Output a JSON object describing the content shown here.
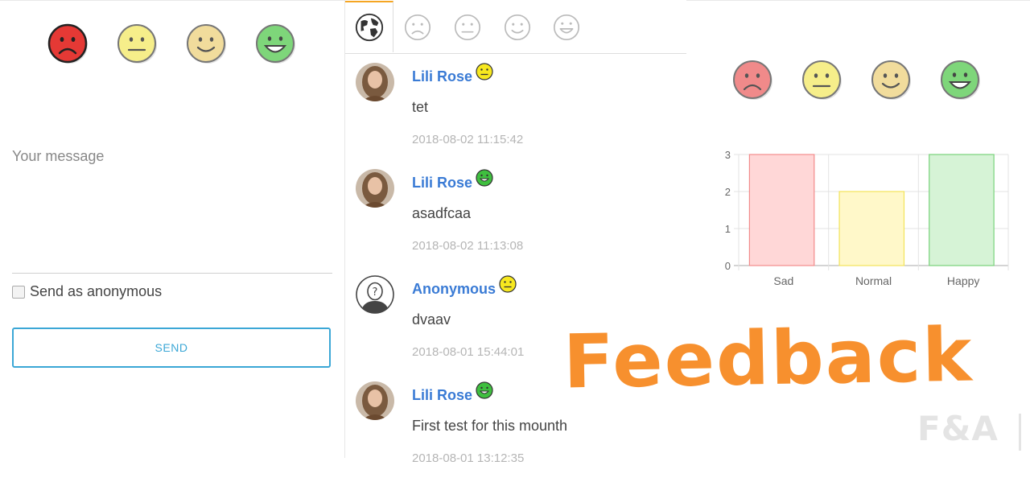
{
  "form": {
    "message_placeholder": "Your message",
    "anonymous_label": "Send as anonymous",
    "send_label": "SEND",
    "moods": [
      {
        "name": "sad",
        "color": "#e53935"
      },
      {
        "name": "normal",
        "color": "#f6ee8a"
      },
      {
        "name": "happy",
        "color": "#f1dc9c"
      },
      {
        "name": "very-happy",
        "color": "#7ed67a"
      }
    ]
  },
  "feed": {
    "tabs": [
      "globe-icon",
      "sad-face-icon",
      "neutral-face-icon",
      "smile-face-icon",
      "happy-face-icon"
    ],
    "accent": "#f5a623",
    "items": [
      {
        "name": "Lili Rose",
        "mood": "neutral",
        "text": "tet",
        "time": "2018-08-02 11:15:42",
        "avatar": "photo"
      },
      {
        "name": "Lili Rose",
        "mood": "happy",
        "text": "asadfcaa",
        "time": "2018-08-02 11:13:08",
        "avatar": "photo"
      },
      {
        "name": "Anonymous",
        "mood": "neutral",
        "text": "dvaav",
        "time": "2018-08-01 15:44:01",
        "avatar": "anonymous"
      },
      {
        "name": "Lili Rose",
        "mood": "happy",
        "text": "First test for this mounth",
        "time": "2018-08-01 13:12:35",
        "avatar": "photo"
      }
    ]
  },
  "stats": {
    "moods": [
      {
        "name": "sad",
        "color": "#f08a8a"
      },
      {
        "name": "normal",
        "color": "#f6ee8a"
      },
      {
        "name": "happy",
        "color": "#f1dc9c"
      },
      {
        "name": "very-happy",
        "color": "#7ed67a"
      }
    ]
  },
  "chart_data": {
    "type": "bar",
    "categories": [
      "Sad",
      "Normal",
      "Happy"
    ],
    "values": [
      3,
      2,
      3
    ],
    "colors": [
      "#f28b8b",
      "#f2e35a",
      "#79d27a"
    ],
    "fills": [
      "#ffd7d7",
      "#fff8c9",
      "#d6f3d6"
    ],
    "ylim": [
      0,
      3
    ],
    "yticks": [
      0,
      1,
      2,
      3
    ],
    "grid": true
  },
  "branding": {
    "title": "Feedback",
    "watermark": "F&A"
  }
}
